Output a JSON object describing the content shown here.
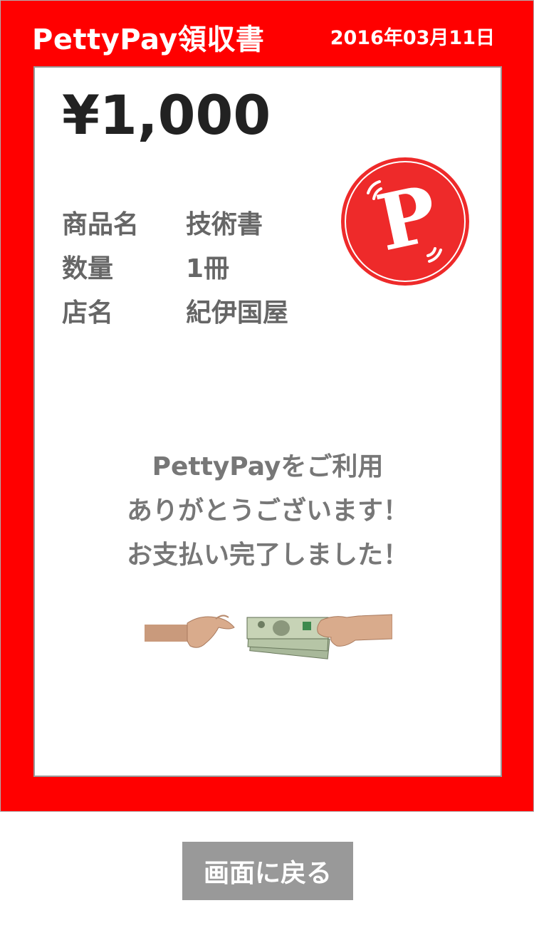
{
  "header": {
    "title": "PettyPay領収書",
    "date": "2016年03月11日"
  },
  "receipt": {
    "amount": "¥1,000",
    "details": [
      {
        "label": "商品名",
        "value": "技術書"
      },
      {
        "label": "数量",
        "value": "1冊"
      },
      {
        "label": "店名",
        "value": "紀伊国屋"
      }
    ],
    "logo_letter": "P",
    "message": [
      "PettyPayをご利用",
      "ありがとうございます！",
      "お支払い完了しました！"
    ]
  },
  "footer": {
    "back_label": "画面に戻る"
  },
  "colors": {
    "brand_red": "#ff0000",
    "logo_red": "#ee2a2a",
    "button_gray": "#999999"
  },
  "icons": {
    "logo": "pettypay-logo-icon",
    "payment_image": "hands-exchanging-money-image"
  }
}
